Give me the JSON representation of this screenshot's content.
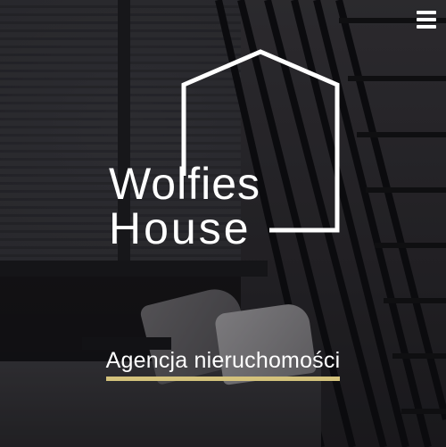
{
  "header": {
    "menu_icon": "hamburger-menu-icon"
  },
  "logo": {
    "line1": "Wolfies",
    "line2": "House",
    "icon": "house-outline-icon"
  },
  "hero": {
    "tagline": "Agencja nieruchomości"
  },
  "colors": {
    "accent": "#d4c27c",
    "text": "#ffffff",
    "background": "#222125"
  }
}
